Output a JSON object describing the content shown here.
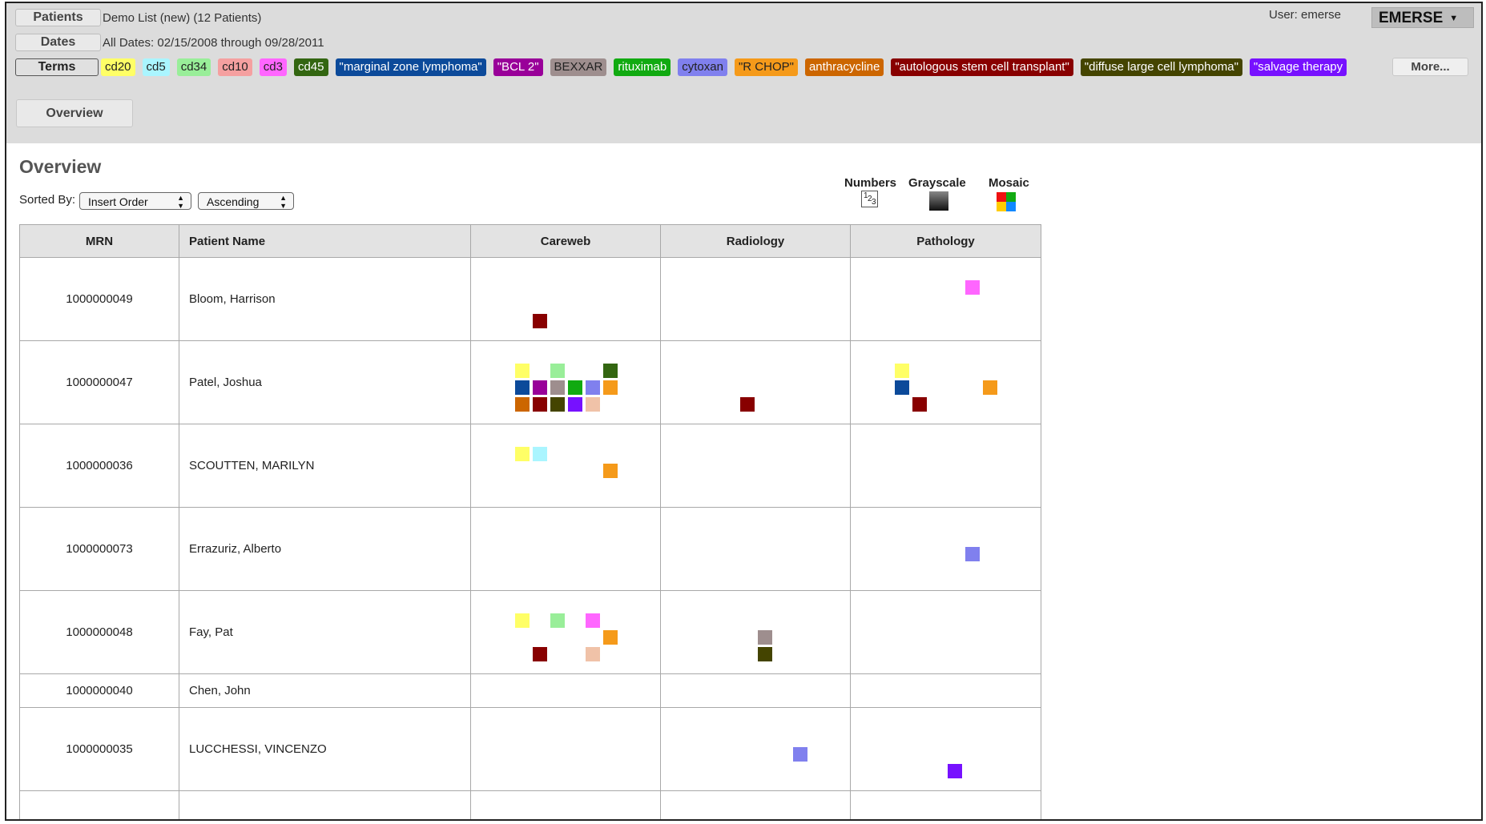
{
  "header": {
    "patients_label": "Patients",
    "patients_value": "Demo List (new) (12 Patients)",
    "dates_label": "Dates",
    "dates_value": "All Dates: 02/15/2008 through 09/28/2011",
    "terms_label": "Terms",
    "more_label": "More...",
    "user_text": "User: emerse",
    "app_menu_label": "EMERSE"
  },
  "terms": [
    {
      "label": "cd20",
      "bg": "#ffff66",
      "fg": "#222222"
    },
    {
      "label": "cd5",
      "bg": "#aaf5ff",
      "fg": "#222222"
    },
    {
      "label": "cd34",
      "bg": "#99ee99",
      "fg": "#222222"
    },
    {
      "label": "cd10",
      "bg": "#f5a0a0",
      "fg": "#222222"
    },
    {
      "label": "cd3",
      "bg": "#ff66ff",
      "fg": "#222222"
    },
    {
      "label": "cd45",
      "bg": "#336611",
      "fg": "#ffffff"
    },
    {
      "label": "\"marginal zone lymphoma\"",
      "bg": "#0c4a9a",
      "fg": "#ffffff"
    },
    {
      "label": "\"BCL 2\"",
      "bg": "#990099",
      "fg": "#ffffff"
    },
    {
      "label": "BEXXAR",
      "bg": "#9e8e8e",
      "fg": "#222222"
    },
    {
      "label": "rituximab",
      "bg": "#11aa11",
      "fg": "#ffffff"
    },
    {
      "label": "cytoxan",
      "bg": "#8080ee",
      "fg": "#222222"
    },
    {
      "label": "\"R CHOP\"",
      "bg": "#f59a1a",
      "fg": "#222222"
    },
    {
      "label": "anthracycline",
      "bg": "#cc6600",
      "fg": "#ffffff"
    },
    {
      "label": "\"autologous stem cell transplant\"",
      "bg": "#880000",
      "fg": "#ffffff"
    },
    {
      "label": "\"diffuse large cell lymphoma\"",
      "bg": "#444400",
      "fg": "#ffffff"
    },
    {
      "label": "\"salvage therapy",
      "bg": "#7711ff",
      "fg": "#ffffff"
    }
  ],
  "tabs": {
    "overview": "Overview"
  },
  "page": {
    "title": "Overview",
    "sorted_by_label": "Sorted By:",
    "sort_field": "Insert Order",
    "sort_order": "Ascending"
  },
  "view_modes": {
    "numbers": "Numbers",
    "grayscale": "Grayscale",
    "mosaic": "Mosaic"
  },
  "table": {
    "columns": [
      "MRN",
      "Patient Name",
      "Careweb",
      "Radiology",
      "Pathology"
    ],
    "rows": [
      {
        "mrn": "1000000049",
        "name": "Bloom, Harrison",
        "careweb": [
          {
            "c": "#880000",
            "col": 1,
            "row": 2
          }
        ],
        "radiology": [],
        "pathology": [
          {
            "c": "#ff66ff",
            "col": 4,
            "row": 0
          }
        ]
      },
      {
        "mrn": "1000000047",
        "name": "Patel, Joshua",
        "careweb": [
          {
            "c": "#ffff66",
            "col": 0,
            "row": 0
          },
          {
            "c": "#99ee99",
            "col": 2,
            "row": 0
          },
          {
            "c": "#336611",
            "col": 5,
            "row": 0
          },
          {
            "c": "#0c4a9a",
            "col": 0,
            "row": 1
          },
          {
            "c": "#990099",
            "col": 1,
            "row": 1
          },
          {
            "c": "#9e8e8e",
            "col": 2,
            "row": 1
          },
          {
            "c": "#11aa11",
            "col": 3,
            "row": 1
          },
          {
            "c": "#8080ee",
            "col": 4,
            "row": 1
          },
          {
            "c": "#f59a1a",
            "col": 5,
            "row": 1
          },
          {
            "c": "#cc6600",
            "col": 0,
            "row": 2
          },
          {
            "c": "#880000",
            "col": 1,
            "row": 2
          },
          {
            "c": "#444400",
            "col": 2,
            "row": 2
          },
          {
            "c": "#7711ff",
            "col": 3,
            "row": 2
          },
          {
            "c": "#f0c2a8",
            "col": 4,
            "row": 2
          }
        ],
        "radiology": [
          {
            "c": "#880000",
            "col": 2,
            "row": 2
          }
        ],
        "pathology": [
          {
            "c": "#ffff66",
            "col": 0,
            "row": 0
          },
          {
            "c": "#0c4a9a",
            "col": 0,
            "row": 1
          },
          {
            "c": "#880000",
            "col": 1,
            "row": 2
          },
          {
            "c": "#f59a1a",
            "col": 5,
            "row": 1
          }
        ]
      },
      {
        "mrn": "1000000036",
        "name": "SCOUTTEN, MARILYN",
        "careweb": [
          {
            "c": "#ffff66",
            "col": 0,
            "row": 0
          },
          {
            "c": "#aaf5ff",
            "col": 1,
            "row": 0
          },
          {
            "c": "#f59a1a",
            "col": 5,
            "row": 1
          }
        ],
        "radiology": [],
        "pathology": []
      },
      {
        "mrn": "1000000073",
        "name": "Errazuriz, Alberto",
        "careweb": [],
        "radiology": [],
        "pathology": [
          {
            "c": "#8080ee",
            "col": 4,
            "row": 1
          }
        ]
      },
      {
        "mrn": "1000000048",
        "name": "Fay, Pat",
        "careweb": [
          {
            "c": "#ffff66",
            "col": 0,
            "row": 0
          },
          {
            "c": "#99ee99",
            "col": 2,
            "row": 0
          },
          {
            "c": "#ff66ff",
            "col": 4,
            "row": 0
          },
          {
            "c": "#f59a1a",
            "col": 5,
            "row": 1
          },
          {
            "c": "#880000",
            "col": 1,
            "row": 2
          },
          {
            "c": "#f0c2a8",
            "col": 4,
            "row": 2
          }
        ],
        "radiology": [
          {
            "c": "#9e8e8e",
            "col": 3,
            "row": 1
          },
          {
            "c": "#444400",
            "col": 3,
            "row": 2
          }
        ],
        "pathology": []
      },
      {
        "mrn": "1000000040",
        "name": "Chen, John",
        "careweb": [],
        "radiology": [],
        "pathology": []
      },
      {
        "mrn": "1000000035",
        "name": "LUCCHESSI, VINCENZO",
        "careweb": [],
        "radiology": [
          {
            "c": "#8080ee",
            "col": 5,
            "row": 1
          }
        ],
        "pathology": [
          {
            "c": "#7711ff",
            "col": 3,
            "row": 2
          }
        ]
      },
      {
        "mrn": "",
        "name": "",
        "careweb": [],
        "radiology": [],
        "pathology": []
      }
    ]
  }
}
